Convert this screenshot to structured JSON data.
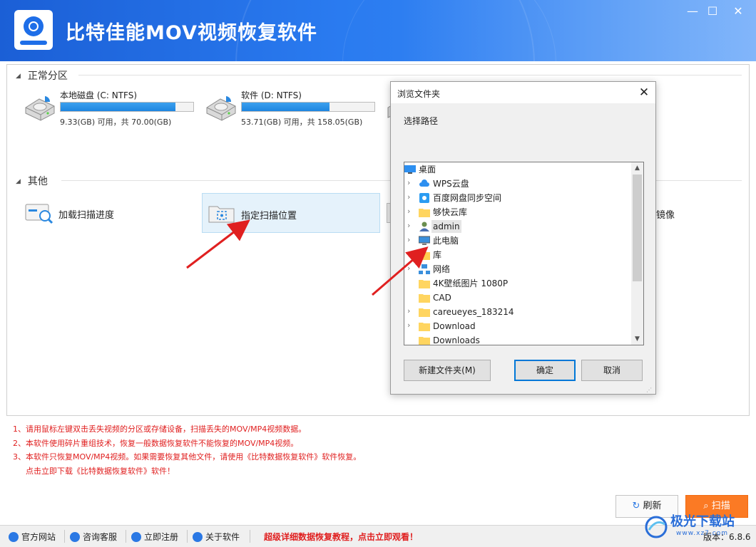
{
  "app": {
    "title": "比特佳能MOV视频恢复软件",
    "window_controls": {
      "minimize": "—",
      "maximize": "☐",
      "close": "✕"
    }
  },
  "sections": {
    "normal_partitions": {
      "title": "正常分区",
      "drives": [
        {
          "name": "本地磁盘 (C: NTFS)",
          "info": "9.33(GB) 可用，共 70.00(GB)",
          "used_fraction": 0.867
        },
        {
          "name": "软件 (D: NTFS)",
          "info": "53.71(GB) 可用，共 158.05(GB)",
          "used_fraction": 0.66
        }
      ]
    },
    "other": {
      "title": "其他",
      "items": [
        {
          "label": "加载扫描进度",
          "icon": "scan-progress-icon"
        },
        {
          "label": "指定扫描位置",
          "icon": "folder-scan-icon"
        },
        {
          "label": "镜像",
          "icon": "disk-image-icon"
        }
      ]
    }
  },
  "notes": [
    "1、请用鼠标左键双击丢失视频的分区或存储设备，扫描丢失的MOV/MP4视频数据。",
    "2、本软件使用碎片重组技术，恢复一般数据恢复软件不能恢复的MOV/MP4视频。",
    "3、本软件只恢复MOV/MP4视频。如果需要恢复其他文件，请使用《比特数据恢复软件》软件恢复。",
    "点击立即下载《比特数据恢复软件》软件！"
  ],
  "actions": {
    "refresh": "刷新",
    "scan": "扫描"
  },
  "statusbar": {
    "items": [
      "官方网站",
      "咨询客服",
      "立即注册",
      "关于软件"
    ],
    "promo": "超级详细数据恢复教程，点击立即观看！",
    "version": "版本：6.8.6"
  },
  "watermark": {
    "text": "极光下载站",
    "sub": "www.xz7.com"
  },
  "dialog": {
    "title": "浏览文件夹",
    "close": "✕",
    "instruction": "选择路径",
    "tree": [
      {
        "label": "桌面",
        "icon": "desktop-icon",
        "expandable": false,
        "level": 0
      },
      {
        "label": "WPS云盘",
        "icon": "wps-cloud-icon",
        "expandable": true,
        "level": 1
      },
      {
        "label": "百度网盘同步空间",
        "icon": "baidu-sync-icon",
        "expandable": true,
        "level": 1
      },
      {
        "label": "够快云库",
        "icon": "folder-icon",
        "expandable": true,
        "level": 1
      },
      {
        "label": "admin",
        "icon": "user-icon",
        "expandable": true,
        "level": 1,
        "highlight": true
      },
      {
        "label": "此电脑",
        "icon": "computer-icon",
        "expandable": true,
        "level": 1
      },
      {
        "label": "库",
        "icon": "library-icon",
        "expandable": true,
        "level": 1
      },
      {
        "label": "网络",
        "icon": "network-icon",
        "expandable": true,
        "level": 1
      },
      {
        "label": "4K壁纸图片 1080P",
        "icon": "folder-icon",
        "expandable": false,
        "level": 1
      },
      {
        "label": "CAD",
        "icon": "folder-icon",
        "expandable": false,
        "level": 1
      },
      {
        "label": "careueyes_183214",
        "icon": "folder-icon",
        "expandable": true,
        "level": 1
      },
      {
        "label": "Download",
        "icon": "folder-icon",
        "expandable": true,
        "level": 1
      },
      {
        "label": "Downloads",
        "icon": "folder-icon",
        "expandable": false,
        "level": 1
      }
    ],
    "buttons": {
      "new_folder": "新建文件夹(M)",
      "ok": "确定",
      "cancel": "取消"
    }
  },
  "colors": {
    "title_bar": "#2a7bf0",
    "accent": "#1e86e0",
    "scan_button": "#fb7a24",
    "notes_text": "#e02020"
  }
}
